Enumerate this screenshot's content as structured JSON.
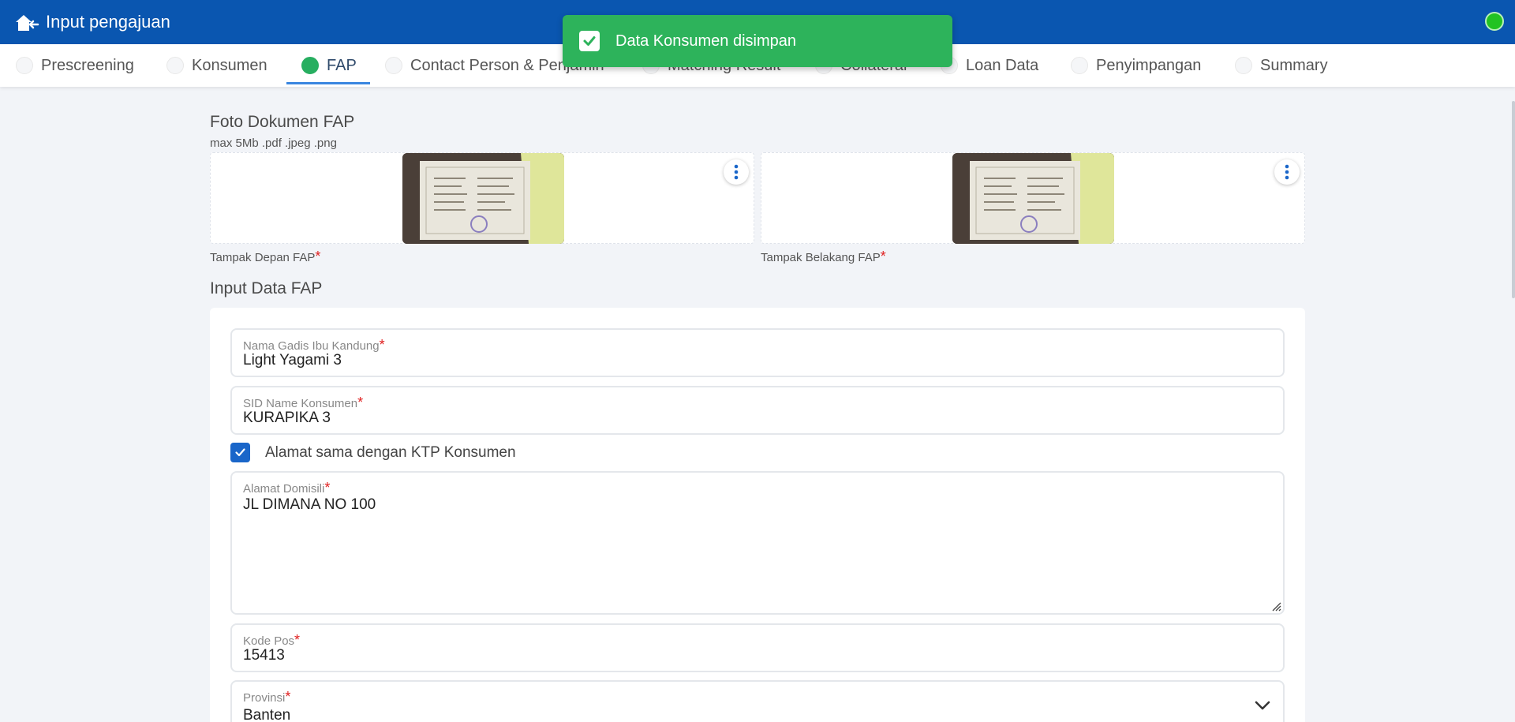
{
  "appbar": {
    "title": "Input pengajuan"
  },
  "tabs": [
    {
      "label": "Prescreening"
    },
    {
      "label": "Konsumen"
    },
    {
      "label": "FAP"
    },
    {
      "label": "Contact Person & Penjamin"
    },
    {
      "label": "Matching Result"
    },
    {
      "label": "Collateral"
    },
    {
      "label": "Loan Data"
    },
    {
      "label": "Penyimpangan"
    },
    {
      "label": "Summary"
    }
  ],
  "active_tab": "FAP",
  "toast": {
    "message": "Data Konsumen disimpan"
  },
  "documents": {
    "title": "Foto Dokumen FAP",
    "hint": "max 5Mb .pdf .jpeg .png",
    "front_label": "Tampak Depan FAP",
    "back_label": "Tampak Belakang FAP",
    "required_mark": "*"
  },
  "form": {
    "title": "Input Data FAP",
    "mother_name": {
      "label": "Nama Gadis Ibu Kandung",
      "value": "Light Yagami 3"
    },
    "sid_name": {
      "label": "SID Name Konsumen",
      "value": "KURAPIKA 3"
    },
    "same_address": {
      "label": "Alamat sama dengan KTP Konsumen",
      "checked": true
    },
    "address": {
      "label": "Alamat Domisili",
      "value": "JL DIMANA NO 100"
    },
    "postal_code": {
      "label": "Kode Pos",
      "value": "15413"
    },
    "province": {
      "label": "Provinsi",
      "value": "Banten"
    }
  },
  "colors": {
    "primary": "#0a56b0",
    "success": "#2db35b",
    "required": "#e02020"
  }
}
